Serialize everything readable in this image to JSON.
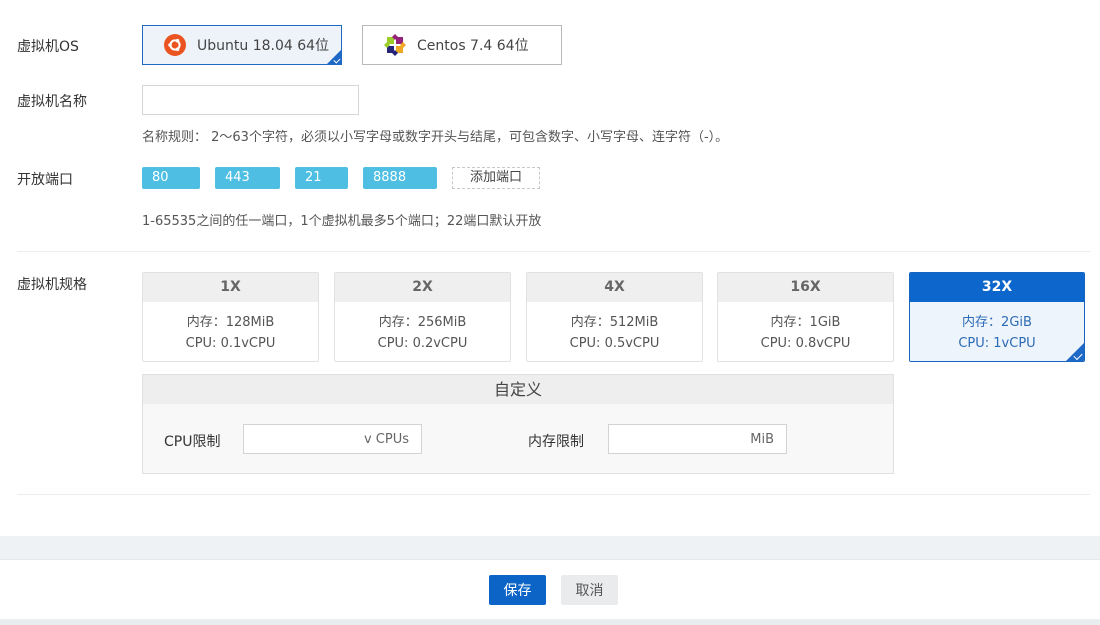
{
  "labels": {
    "os": "虚拟机OS",
    "name": "虚拟机名称",
    "ports": "开放端口",
    "spec": "虚拟机规格"
  },
  "os_options": [
    {
      "name": "Ubuntu 18.04 64位",
      "icon": "ubuntu-icon",
      "selected": true,
      "color": "#e95420"
    },
    {
      "name": "Centos 7.4 64位",
      "icon": "centos-icon",
      "selected": false
    }
  ],
  "name_field": {
    "value": "",
    "placeholder": ""
  },
  "name_rule": "名称规则： 2～63个字符，必须以小写字母或数字开头与结尾，可包含数字、小写字母、连字符（-）。",
  "ports": [
    "80",
    "443",
    "21",
    "8888"
  ],
  "add_port_label": "添加端口",
  "port_hint": "1-65535之间的任一端口，1个虚拟机最多5个端口；22端口默认开放",
  "specs": [
    {
      "title": "1X",
      "mem": "内存：128MiB",
      "cpu": "CPU: 0.1vCPU",
      "selected": false
    },
    {
      "title": "2X",
      "mem": "内存：256MiB",
      "cpu": "CPU: 0.2vCPU",
      "selected": false
    },
    {
      "title": "4X",
      "mem": "内存：512MiB",
      "cpu": "CPU: 0.5vCPU",
      "selected": false
    },
    {
      "title": "16X",
      "mem": "内存：1GiB",
      "cpu": "CPU: 0.8vCPU",
      "selected": false
    },
    {
      "title": "32X",
      "mem": "内存：2GiB",
      "cpu": "CPU: 1vCPU",
      "selected": true
    }
  ],
  "custom": {
    "title": "自定义",
    "cpu_label": "CPU限制",
    "cpu_unit": "v CPUs",
    "cpu_value": "",
    "mem_label": "内存限制",
    "mem_unit": "MiB",
    "mem_value": ""
  },
  "footer": {
    "save": "保存",
    "cancel": "取消"
  },
  "colors": {
    "primary": "#0c64c6",
    "port_tag": "#4ebfe3"
  }
}
